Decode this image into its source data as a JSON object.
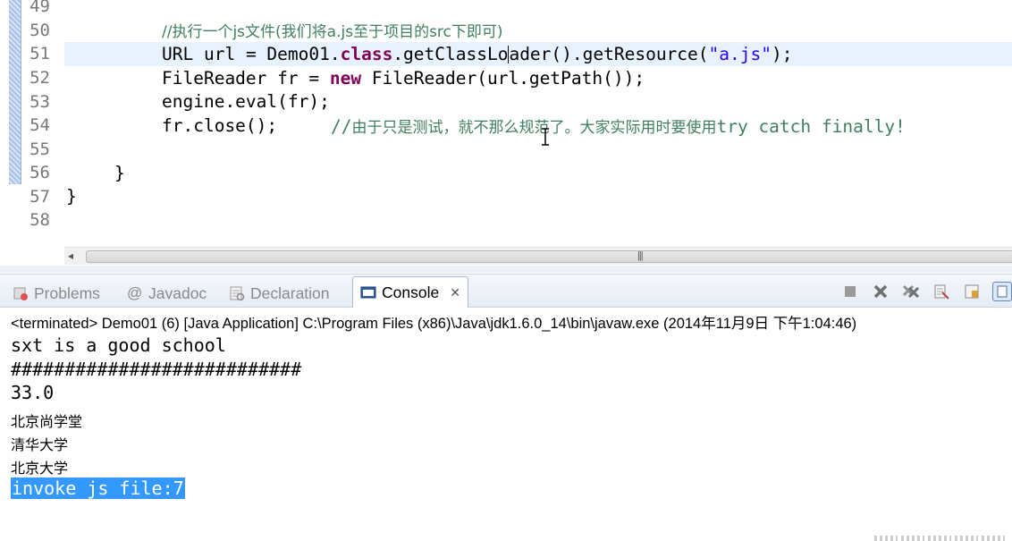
{
  "editor": {
    "line_numbers": [
      "49",
      "50",
      "51",
      "52",
      "53",
      "54",
      "55",
      "56",
      "57",
      "58"
    ],
    "line50_comment": "//执行一个js文件(我们将a.js至于项目的src下即可)",
    "line51": {
      "type": "URL ",
      "var": "url",
      "op": " = Demo01.",
      "kw_class": "class",
      "call_a": ".getClassLo",
      "call_b": "ader().getResource(",
      "string": "\"a.js\"",
      "end": ");"
    },
    "line52": {
      "start": "FileReader fr = ",
      "kw_new": "new",
      "call": " FileReader(url.getPath());"
    },
    "line53": "engine.eval(fr);",
    "line54": {
      "code": "fr.close();",
      "comment_prefix": "//",
      "comment_zh": "由于只是测试，就不那么规范了。大家实际用时要使用",
      "comment_tail": "try catch finally!"
    },
    "line56": "}",
    "line57": "}"
  },
  "console": {
    "tabs": [
      {
        "label": "Problems",
        "icon": "problems-icon"
      },
      {
        "label": "Javadoc",
        "icon": "at-icon"
      },
      {
        "label": "Declaration",
        "icon": "declaration-icon"
      },
      {
        "label": "Console",
        "icon": "console-icon"
      }
    ],
    "status": "<terminated> Demo01 (6) [Java Application] C:\\Program Files (x86)\\Java\\jdk1.6.0_14\\bin\\javaw.exe (2014年11月9日 下午1:04:46)",
    "output": [
      "sxt is a good school",
      "###########################",
      "33.0",
      "北京尚学堂",
      "清华大学",
      "北京大学"
    ],
    "selected_output": "invoke js file:7"
  }
}
